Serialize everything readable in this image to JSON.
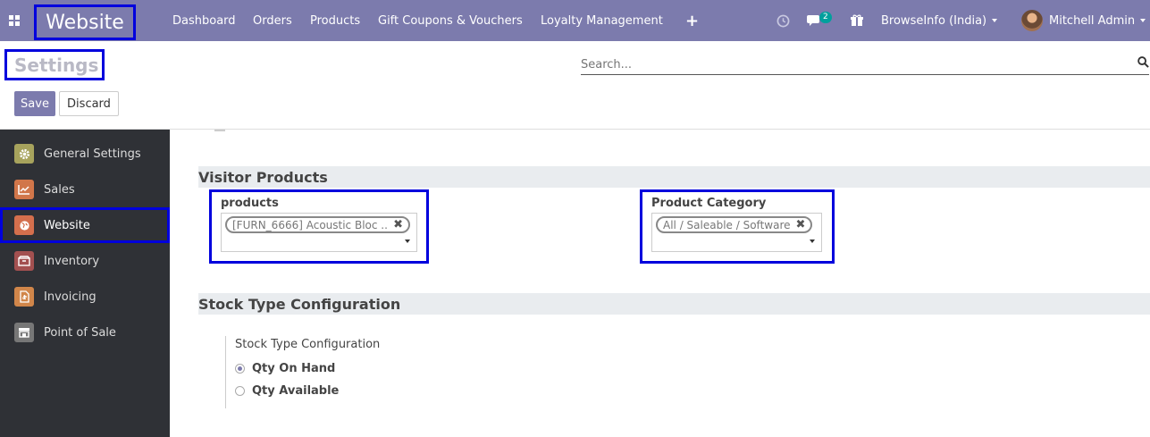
{
  "topbar": {
    "brand": "Website",
    "menu": [
      "Dashboard",
      "Orders",
      "Products",
      "Gift Coupons & Vouchers",
      "Loyalty Management"
    ],
    "plus": "+",
    "message_count": "2",
    "company": "BrowseInfo (India)",
    "user": "Mitchell Admin"
  },
  "control_panel": {
    "title": "Settings",
    "search_placeholder": "Search...",
    "save_label": "Save",
    "discard_label": "Discard"
  },
  "sidebar": {
    "items": [
      {
        "label": "General Settings",
        "icon": "gear-icon",
        "color": "#a7a35d"
      },
      {
        "label": "Sales",
        "icon": "chart-icon",
        "color": "#d1764a"
      },
      {
        "label": "Website",
        "icon": "globe-icon",
        "color": "#d46f4d"
      },
      {
        "label": "Inventory",
        "icon": "box-icon",
        "color": "#a35050"
      },
      {
        "label": "Invoicing",
        "icon": "invoice-icon",
        "color": "#d1864a"
      },
      {
        "label": "Point of Sale",
        "icon": "shop-icon",
        "color": "#777777"
      }
    ],
    "active": "Website"
  },
  "visitor_products": {
    "heading": "Visitor Products",
    "products_label": "products",
    "products_tag": "[FURN_6666] Acoustic Bloc ...",
    "category_label": "Product Category",
    "category_tag": "All / Saleable / Software"
  },
  "stock_type": {
    "heading": "Stock Type Configuration",
    "field_label": "Stock Type Configuration",
    "options": [
      "Qty On Hand",
      "Qty Available"
    ],
    "selected": "Qty On Hand"
  },
  "colors": {
    "brand": "#7c7bad",
    "highlight": "#0000dd",
    "sidebar_bg": "#2f3136",
    "badge": "#00a09d"
  }
}
